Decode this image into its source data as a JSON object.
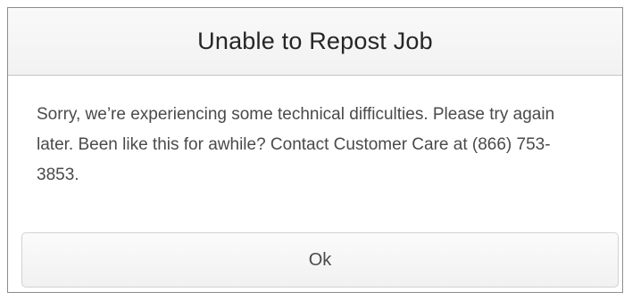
{
  "dialog": {
    "title": "Unable to Repost Job",
    "message": "Sorry, we’re experiencing some technical difficulties. Please try again later. Been like this for awhile? Contact Customer Care at (866) 753-3853.",
    "ok_label": "Ok"
  }
}
